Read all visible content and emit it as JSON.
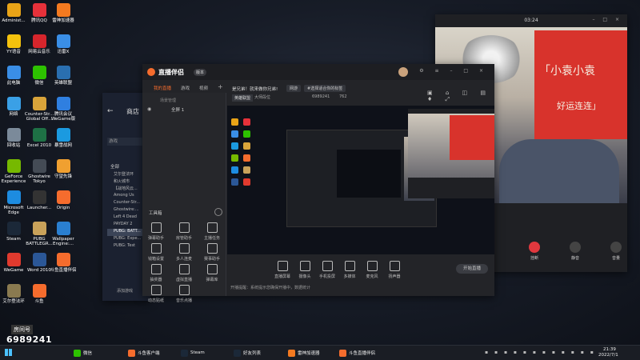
{
  "desktop_icons": [
    {
      "label": "Administ...",
      "color": "#e8a317"
    },
    {
      "label": "腾讯QQ",
      "color": "#e6313a"
    },
    {
      "label": "雷神加速器",
      "color": "#f47a20"
    },
    {
      "label": "YY语音",
      "color": "#f4c20d"
    },
    {
      "label": "网易云音乐",
      "color": "#d6252c"
    },
    {
      "label": "迅雷X",
      "color": "#3a8ee6"
    },
    {
      "label": "此电脑",
      "color": "#3a8ee6"
    },
    {
      "label": "微信",
      "color": "#2dc100"
    },
    {
      "label": "英雄联盟",
      "color": "#2a6fb0"
    },
    {
      "label": "网络",
      "color": "#3aa0e6"
    },
    {
      "label": "Counter-Str... Global Off...",
      "color": "#d9a43a"
    },
    {
      "label": "腾讯会议 WeGame版",
      "color": "#2f7fe0"
    },
    {
      "label": "回收站",
      "color": "#7b8a9a"
    },
    {
      "label": "Excel 2010",
      "color": "#1e7145"
    },
    {
      "label": "暴雪战网",
      "color": "#1b9ae0"
    },
    {
      "label": "GeForce Experience",
      "color": "#76b900"
    },
    {
      "label": "Ghostwire Tokyo",
      "color": "#444b55"
    },
    {
      "label": "守望先锋",
      "color": "#f0a030"
    },
    {
      "label": "Microsoft Edge",
      "color": "#1d8ce0"
    },
    {
      "label": "Launcher...",
      "color": "#333"
    },
    {
      "label": "Origin",
      "color": "#f56c2d"
    },
    {
      "label": "Steam",
      "color": "#1b2838"
    },
    {
      "label": "PUBG BATTLEGR...",
      "color": "#c9a25a"
    },
    {
      "label": "Wallpaper Engine:...",
      "color": "#2a7fd0"
    },
    {
      "label": "WeGame",
      "color": "#e03a2e"
    },
    {
      "label": "Word 2010",
      "color": "#2b5797"
    },
    {
      "label": "斗鱼直播伴侣",
      "color": "#f56c2d"
    },
    {
      "label": "艾尔登法环",
      "color": "#8a7a50"
    },
    {
      "label": "斗鱼",
      "color": "#f56c2d"
    }
  ],
  "room_badge": {
    "label": "房间号",
    "number": "6989241"
  },
  "steam": {
    "title": "商店",
    "search_placeholder": "游戏",
    "section": "全部",
    "games": [
      "艾尔登法环",
      "和火城市",
      "【战地风云...",
      "Among Us",
      "Counter-Str...",
      "Ghostwire:...",
      "Left 4 Dead",
      "PAYDAY 2",
      "PUBG: BATT...",
      "PUBG: Expe...",
      "PUBG: Test"
    ],
    "add_game": "添加游戏"
  },
  "douyu": {
    "app_name": "直播伴侣",
    "app_badge": "版本",
    "tabs": [
      "我的直播",
      "游戏",
      "视频"
    ],
    "scene_label": "场景管理",
    "scene_item": "全屏 1",
    "title_label": "是兄弟！就来做你兄弟!",
    "tag1": "网游",
    "tag2": "#选择适合你的标签",
    "category": "英雄联盟",
    "category_sub": "大师段位",
    "room_id": "6989241",
    "followers": "762",
    "toolbox_label": "工具箱",
    "tools": [
      "弹幕助手",
      "房管助手",
      "主播任务",
      "钱箱设置",
      "多人连麦",
      "赛事助手",
      "抽奖器",
      "虚拟直播",
      "弹幕库",
      "动态贴纸",
      "音乐点播"
    ],
    "tip": "开播提醒：系统提示您确保开播中，数据统计",
    "bottom_controls": [
      "直播屏幕",
      "摄像头",
      "手机投屏",
      "多媒体",
      "麦克风",
      "扬声器"
    ],
    "start_button": "开始直播"
  },
  "video_call": {
    "time": "03:24",
    "sign_line1": "「小袁小袁",
    "sign_line2": "好运连连」",
    "controls": [
      {
        "label": "挂断",
        "color": "#e0383e"
      },
      {
        "label": "静音",
        "color": "#444"
      },
      {
        "label": "音量",
        "color": "#444"
      }
    ]
  },
  "taskbar": {
    "items": [
      {
        "label": "微信",
        "color": "#2dc100"
      },
      {
        "label": "斗鱼客户端",
        "color": "#f56c2d"
      },
      {
        "label": "Steam",
        "color": "#1b2838"
      },
      {
        "label": "好友列表",
        "color": "#1b2838"
      },
      {
        "label": "雷神加速器",
        "color": "#f47a20"
      },
      {
        "label": "斗鱼直播伴侣",
        "color": "#f56c2d"
      }
    ],
    "clock": "21:39",
    "date": "2022/7/1"
  }
}
